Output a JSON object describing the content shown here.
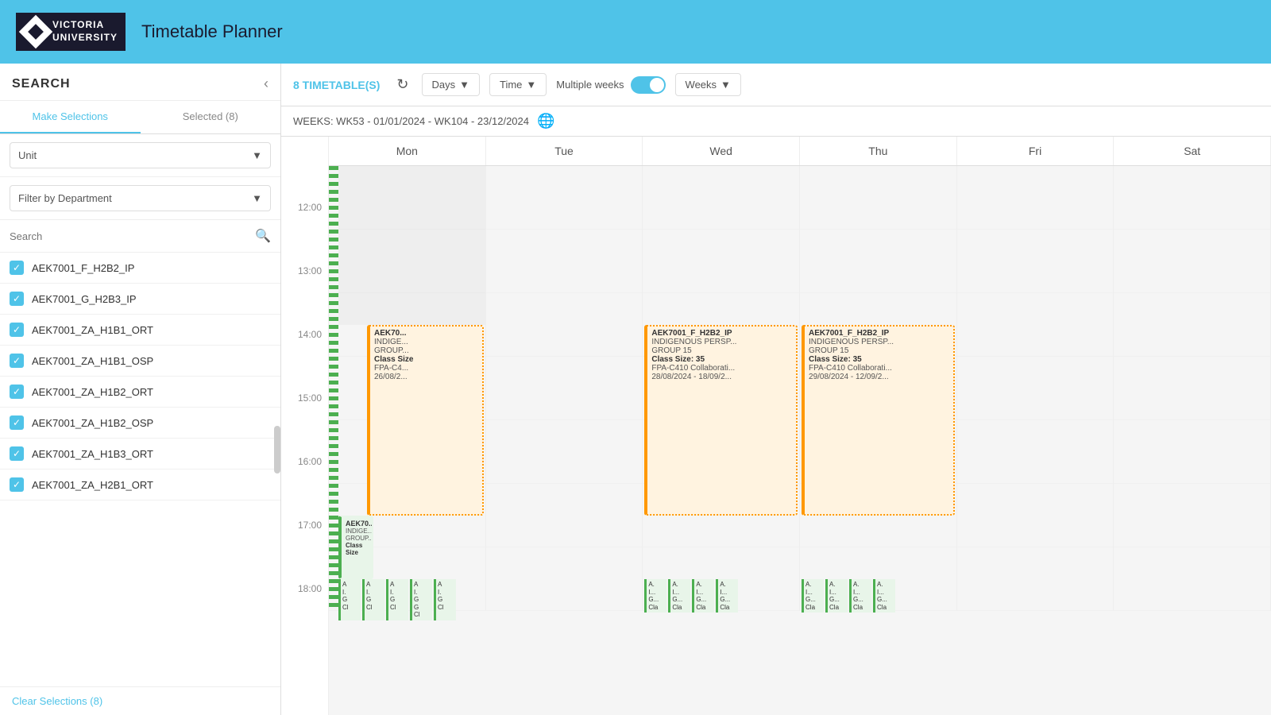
{
  "header": {
    "logo_line1": "VICTORIA",
    "logo_line2": "UNIVERSITY",
    "title": "Timetable Planner"
  },
  "sidebar": {
    "title": "SEARCH",
    "tabs": [
      {
        "label": "Make Selections",
        "active": true
      },
      {
        "label": "Selected (8)",
        "active": false
      }
    ],
    "unit_filter": {
      "label": "Unit",
      "placeholder": "Unit"
    },
    "dept_filter": {
      "label": "Filter by Department"
    },
    "search": {
      "placeholder": "Search"
    },
    "items": [
      {
        "id": "AEK7001_F_H2B2_IP",
        "checked": true
      },
      {
        "id": "AEK7001_G_H2B3_IP",
        "checked": true
      },
      {
        "id": "AEK7001_ZA_H1B1_ORT",
        "checked": true
      },
      {
        "id": "AEK7001_ZA_H1B1_OSP",
        "checked": true
      },
      {
        "id": "AEK7001_ZA_H1B2_ORT",
        "checked": true
      },
      {
        "id": "AEK7001_ZA_H1B2_OSP",
        "checked": true
      },
      {
        "id": "AEK7001_ZA_H1B3_ORT",
        "checked": true
      },
      {
        "id": "AEK7001_ZA_H2B1_ORT",
        "checked": true
      }
    ],
    "clear_btn": "Clear Selections (8)"
  },
  "toolbar": {
    "timetable_count": "8 TIMETABLE(S)",
    "days_label": "Days",
    "time_label": "Time",
    "multiple_weeks_label": "Multiple weeks",
    "weeks_label": "Weeks"
  },
  "week_bar": {
    "text": "WEEKS: WK53 - 01/01/2024 - WK104 - 23/12/2024"
  },
  "calendar": {
    "days": [
      "Mon",
      "Tue",
      "Wed",
      "Thu",
      "Fri",
      "Sat"
    ],
    "times": [
      "12:00",
      "13:00",
      "14:00",
      "15:00",
      "16:00",
      "17:00",
      "18:00"
    ],
    "events": {
      "mon_1": {
        "title": "AEK70...",
        "sub1": "INDIGE...",
        "sub2": "GROUP...",
        "sub3": "Class Size",
        "sub4": "FPA-C4...",
        "sub5": "26/08/2...",
        "type": "orange"
      },
      "mon_2": {
        "title": "AEK70...",
        "sub1": "INDIGE...",
        "sub2": "GROUP...",
        "sub3": "Class Size",
        "type": "orange"
      },
      "wed_1": {
        "title": "AEK7001_F_H2B2_IP",
        "sub1": "INDIGENOUS PERSP...",
        "sub2": "GROUP 15",
        "sub3": "Class Size: 35",
        "sub4": "FPA-C410 Collaborati...",
        "sub5": "28/08/2024 - 18/09/2...",
        "type": "orange"
      },
      "thu_1": {
        "title": "AEK7001_F_H2B2_IP",
        "sub1": "INDIGENOUS PERSP...",
        "sub2": "GROUP 15",
        "sub3": "Class Size: 35",
        "sub4": "FPA-C410 Collaborati...",
        "sub5": "29/08/2024 - 12/09/2...",
        "type": "orange"
      }
    }
  }
}
